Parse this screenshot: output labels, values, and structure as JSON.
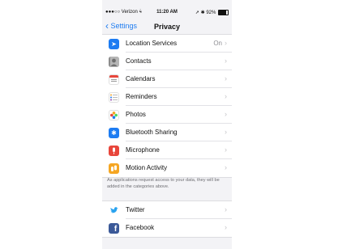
{
  "status": {
    "carrier": "●●●○○ Verizon",
    "wifi": "⩯",
    "time": "11:20 AM",
    "location": "➚",
    "bluetooth": "✱",
    "battery": "92%"
  },
  "nav": {
    "back_label": "Settings",
    "title": "Privacy"
  },
  "rows": [
    {
      "label": "Location Services",
      "value": "On",
      "icon": "location-arrow-icon",
      "color": "#1d7cf2"
    },
    {
      "label": "Contacts",
      "icon": "contacts-icon",
      "color": "#9a9a9a"
    },
    {
      "label": "Calendars",
      "icon": "calendar-icon",
      "color": "#ffffff"
    },
    {
      "label": "Reminders",
      "icon": "reminders-list-icon",
      "color": "#ffffff"
    },
    {
      "label": "Photos",
      "icon": "photos-flower-icon",
      "color": "#ffffff"
    },
    {
      "label": "Bluetooth Sharing",
      "icon": "bluetooth-icon",
      "color": "#1d7cf2"
    },
    {
      "label": "Microphone",
      "icon": "microphone-icon",
      "color": "#e8463b"
    },
    {
      "label": "Motion Activity",
      "icon": "motion-activity-icon",
      "color": "#f5a623"
    }
  ],
  "footer_text": "As applications request access to your data, they will be added in the categories above.",
  "social_rows": [
    {
      "label": "Twitter",
      "icon": "twitter-bird-icon",
      "color": "#ffffff"
    },
    {
      "label": "Facebook",
      "icon": "facebook-icon",
      "color": "#3b5998"
    }
  ]
}
